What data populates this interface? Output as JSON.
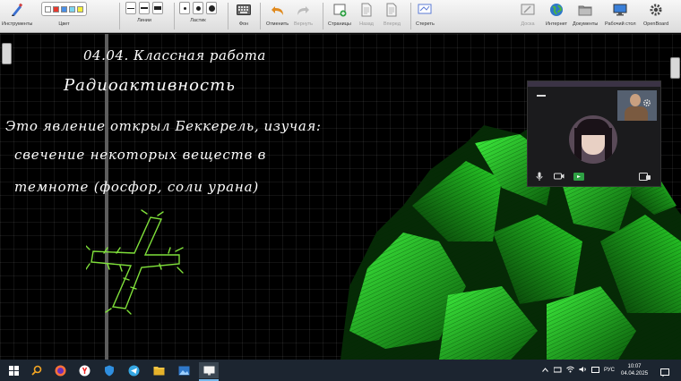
{
  "toolbar": {
    "instruments": "Инструменты",
    "color": "Цвет",
    "lines": "Линии",
    "eraser": "Ластик",
    "background": "Фон",
    "undo": "Отменить",
    "redo": "Вернуть",
    "pages": "Страницы",
    "back": "Назад",
    "forward": "Вперед",
    "erase": "Стереть",
    "board": "Доска",
    "internet": "Интернет",
    "documents": "Документы",
    "desktop": "Рабочий стол",
    "openboard": "OpenBoard"
  },
  "colors": {
    "swatches": [
      "#ffffff",
      "#e83a2f",
      "#4a90e8",
      "#7cd6f0",
      "#f5ee3a"
    ],
    "ink": "#ffffff",
    "highlight_ink": "#7fe03a",
    "crystal": "#1fd21f"
  },
  "board": {
    "date_title": "04.04. Классная работа",
    "topic": "Радиоактивность",
    "line1": "Это явление открыл Беккерель, изучая:",
    "line2": "свечение некоторых веществ в",
    "line3": "темноте (фосфор, соли урана)"
  },
  "call_window": {
    "icons": [
      "settings-icon",
      "mic-icon",
      "camera-icon",
      "screen-share-icon",
      "leave-icon"
    ]
  },
  "taskbar": {
    "language": "РУС",
    "time": "10:07",
    "date": "04.04.2025"
  }
}
